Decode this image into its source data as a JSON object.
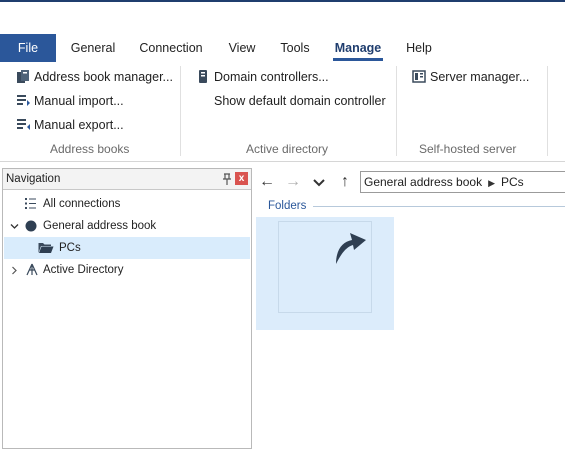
{
  "tabs": {
    "file": "File",
    "general": "General",
    "connection": "Connection",
    "view": "View",
    "tools": "Tools",
    "manage": "Manage",
    "help": "Help",
    "active": "Manage"
  },
  "ribbon": {
    "address_books": {
      "label": "Address books",
      "manager": "Address book manager...",
      "import": "Manual import...",
      "export": "Manual export..."
    },
    "active_directory": {
      "label": "Active directory",
      "domain_controllers": "Domain controllers...",
      "show_default": "Show default domain controller"
    },
    "self_hosted": {
      "label": "Self-hosted server",
      "server_manager": "Server manager..."
    }
  },
  "navigation": {
    "title": "Navigation",
    "close_glyph": "x",
    "items": [
      {
        "label": "All connections",
        "icon": "list-icon",
        "expanded": null
      },
      {
        "label": "General address book",
        "icon": "circle-icon",
        "expanded": true
      },
      {
        "label": "PCs",
        "icon": "folder-open-icon",
        "selected": true
      },
      {
        "label": "Active Directory",
        "icon": "ad-tree-icon",
        "expanded": false
      }
    ]
  },
  "content": {
    "back_glyph": "←",
    "forward_glyph": "→",
    "history_glyph": "⌄",
    "up_glyph": "↑",
    "breadcrumb": {
      "root": "General address book",
      "separator": "▶",
      "current": "PCs"
    },
    "section_label": "Folders"
  },
  "colors": {
    "accent": "#2b579a",
    "selection": "#d9ecfc",
    "tile": "#dcecfb",
    "close_button": "#d9534f"
  }
}
